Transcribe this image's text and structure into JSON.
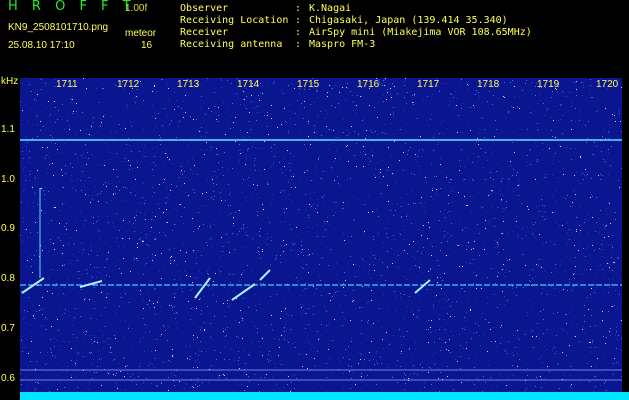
{
  "header": {
    "app_title": "H R O F F T",
    "version": "1.00f",
    "filename": "KN9_2508101710.png",
    "mode": "meteor",
    "timestamp": "25.08.10 17:10",
    "count": "16"
  },
  "info": [
    {
      "key": "Observer",
      "value": "K.Nagai"
    },
    {
      "key": "Receiving Location",
      "value": "Chigasaki, Japan (139.414 35.340)"
    },
    {
      "key": "Receiver",
      "value": "AirSpy mini (Miakejima VOR 108.65MHz)"
    },
    {
      "key": "Receiving antenna",
      "value": "Maspro FM-3"
    }
  ],
  "colon": ":",
  "axis": {
    "y_unit": "kHz",
    "y_ticks": [
      "1.1",
      "1.0",
      "0.9",
      "0.8",
      "0.7",
      "0.6"
    ],
    "x_ticks": [
      "1711",
      "1712",
      "1713",
      "1714",
      "1715",
      "1716",
      "1717",
      "1718",
      "1719",
      "1720"
    ]
  },
  "colors": {
    "background": "#0a1590",
    "trace": "#5fe0ff",
    "label": "#ffff55",
    "title": "#22ee22"
  }
}
